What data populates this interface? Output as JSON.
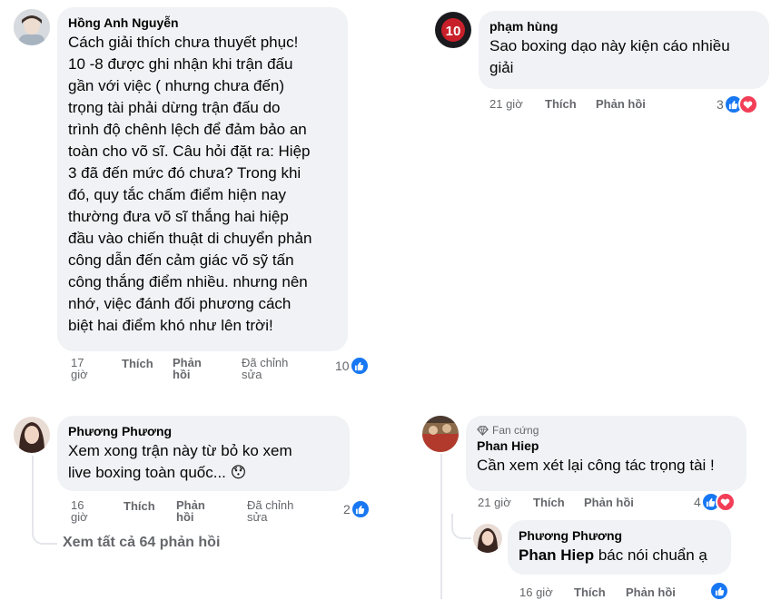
{
  "left": {
    "comment1": {
      "author": "Hồng Anh Nguyễn",
      "lines": [
        "Cách giải thích chưa thuyết phục!",
        "10 -8 được ghi nhận khi trận đấu",
        "gần với việc ( nhưng chưa đến)",
        "trọng tài phải dừng trận đấu do",
        "trình độ chênh lệch để đảm bảo an",
        "toàn cho võ sĩ. Câu hỏi đặt ra: Hiệp",
        "3 đã đến mức đó chưa? Trong khi",
        "đó, quy tắc chấm điểm hiện nay",
        "thường đưa võ sĩ thắng hai hiệp",
        "đầu vào chiến thuật di chuyển phản",
        "công dẫn đến cảm giác võ sỹ tấn",
        "công thắng điểm nhiều. nhưng nên",
        "nhớ, việc đánh đối phương cách",
        "biệt hai điểm khó như lên trời!"
      ],
      "time": [
        "17",
        "giờ"
      ],
      "like": "Thích",
      "reply": [
        "Phản",
        "hồi"
      ],
      "edited": [
        "Đã chỉnh",
        "sửa"
      ],
      "reactions": "10"
    },
    "comment2": {
      "author": "Phương Phương",
      "lines": [
        "Xem xong trận này từ bỏ ko xem",
        "live boxing toàn quốc..."
      ],
      "emoji": "😯",
      "time": [
        "16",
        "giờ"
      ],
      "like": "Thích",
      "reply": [
        "Phản",
        "hồi"
      ],
      "edited": [
        "Đã chỉnh",
        "sửa"
      ],
      "reactions": "2"
    },
    "see_all": "Xem tất cả 64 phản hồi"
  },
  "right": {
    "comment1": {
      "author": "phạm hùng",
      "lines": [
        "Sao boxing dạo này kiện cáo nhiều",
        "giải"
      ],
      "time": "21 giờ",
      "like": "Thích",
      "reply": "Phản hồi",
      "reactions": "3"
    },
    "comment2": {
      "badge": "Fan cứng",
      "author": "Phan Hiep",
      "text": "Cần xem xét lại công tác trọng tài !",
      "time": "21 giờ",
      "like": "Thích",
      "reply": "Phản hồi",
      "reactions": "4"
    },
    "reply1": {
      "author": "Phương Phương",
      "mention": "Phan Hiep",
      "text": " bác nói chuẩn ạ",
      "time": "16 giờ",
      "like": "Thích",
      "reply": "Phản hồi"
    }
  },
  "colors": {
    "like": "#1877f2",
    "heart": "#f33e58",
    "bubble": "#f0f2f5",
    "meta": "#65676b"
  }
}
